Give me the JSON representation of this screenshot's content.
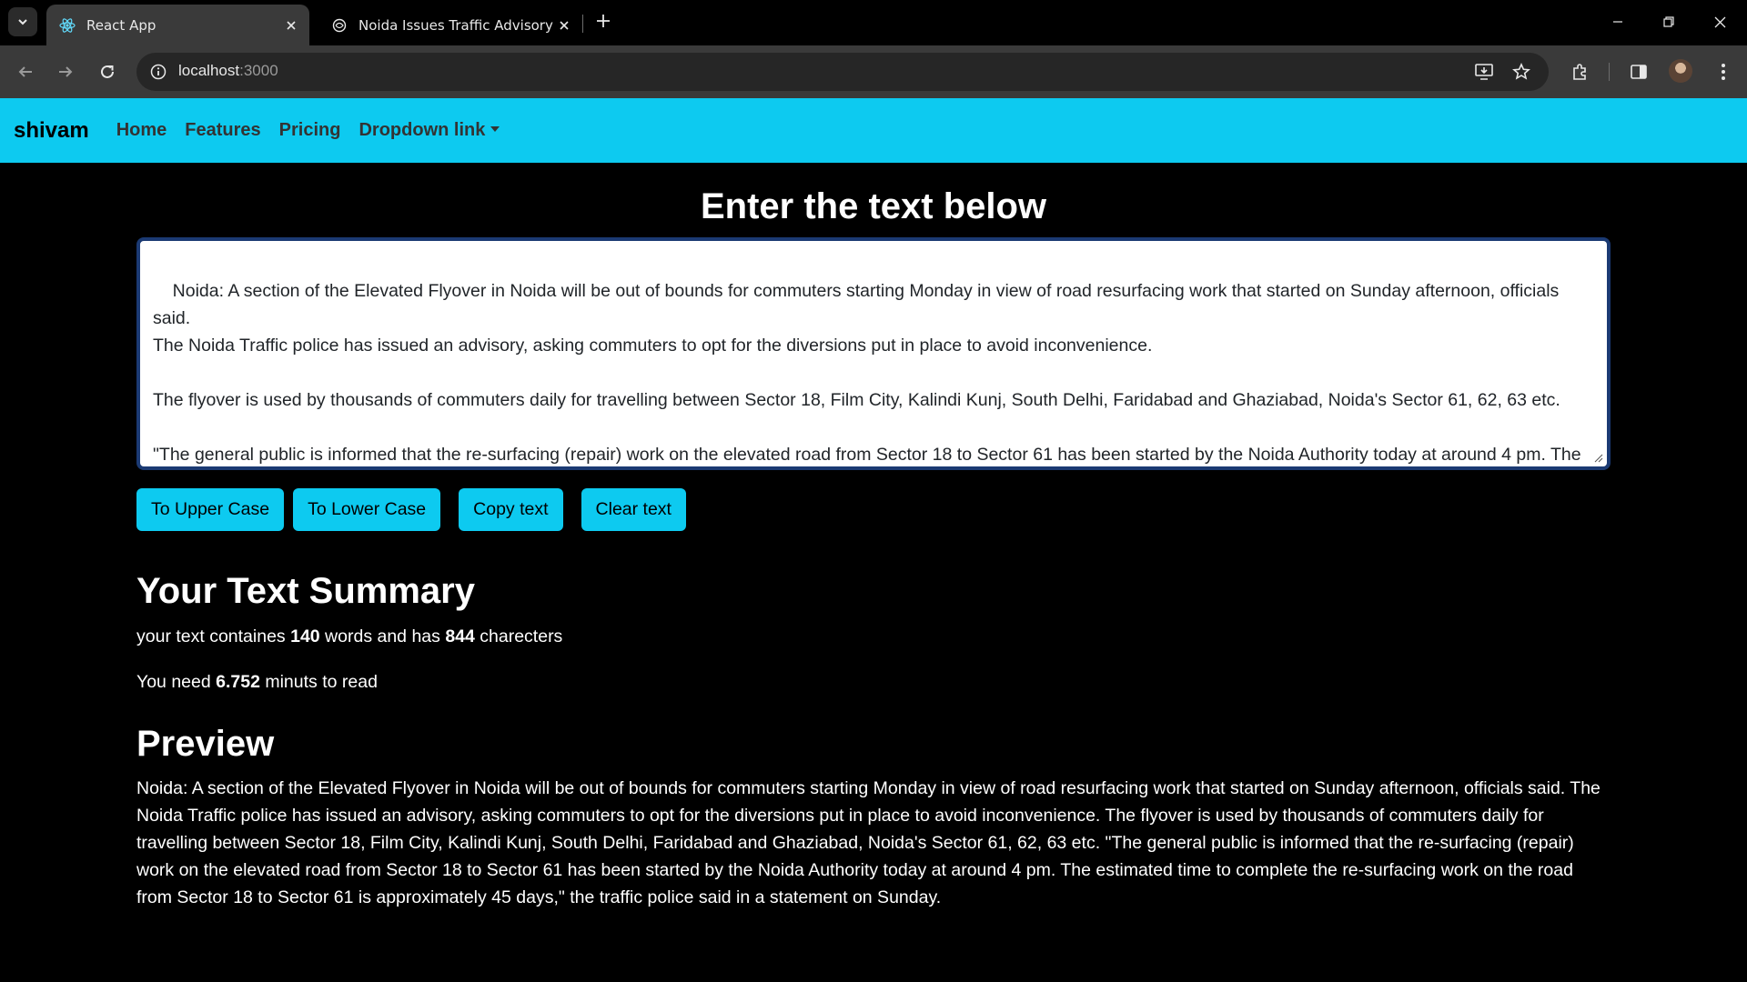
{
  "browser": {
    "tabs": [
      {
        "title": "React App",
        "active": true,
        "icon": "react-icon"
      },
      {
        "title": "Noida Issues Traffic Advisory Ah",
        "active": false,
        "icon": "globe-icon"
      }
    ],
    "url_host": "localhost",
    "url_port": ":3000"
  },
  "navbar": {
    "brand": "shivam",
    "links": [
      "Home",
      "Features",
      "Pricing",
      "Dropdown link"
    ],
    "color": "#0dcaf0"
  },
  "main": {
    "heading": "Enter the text below",
    "textarea_value": "Noida: A section of the Elevated Flyover in Noida will be out of bounds for commuters starting Monday in view of road resurfacing work that started on Sunday afternoon, officials said.\nThe Noida Traffic police has issued an advisory, asking commuters to opt for the diversions put in place to avoid inconvenience.\n\nThe flyover is used by thousands of commuters daily for travelling between Sector 18, Film City, Kalindi Kunj, South Delhi, Faridabad and Ghaziabad, Noida's Sector 61, 62, 63 etc.\n\n\"The general public is informed that the re-surfacing (repair) work on the elevated road from Sector 18 to Sector 61 has been started by the Noida Authority today at around 4 pm. The estimated time to complete the re-surfacing work on the road from Sector 18 to Sector 61 is approximately 45 days,\" the traffic police said in a statement on Sunday.",
    "buttons": {
      "upper": "To Upper Case",
      "lower": "To Lower Case",
      "copy": "Copy text",
      "clear": "Clear text"
    }
  },
  "summary": {
    "title": "Your Text Summary",
    "words_prefix": "your text containes ",
    "words": "140",
    "words_mid": " words and has ",
    "chars": "844",
    "chars_suffix": " charecters",
    "read_prefix": "You need ",
    "read_minutes": "6.752",
    "read_suffix": " minuts to read"
  },
  "preview": {
    "title": "Preview",
    "text": "Noida: A section of the Elevated Flyover in Noida will be out of bounds for commuters starting Monday in view of road resurfacing work that started on Sunday afternoon, officials said. The Noida Traffic police has issued an advisory, asking commuters to opt for the diversions put in place to avoid inconvenience. The flyover is used by thousands of commuters daily for travelling between Sector 18, Film City, Kalindi Kunj, South Delhi, Faridabad and Ghaziabad, Noida's Sector 61, 62, 63 etc. \"The general public is informed that the re-surfacing (repair) work on the elevated road from Sector 18 to Sector 61 has been started by the Noida Authority today at around 4 pm. The estimated time to complete the re-surfacing work on the road from Sector 18 to Sector 61 is approximately 45 days,\" the traffic police said in a statement on Sunday."
  }
}
